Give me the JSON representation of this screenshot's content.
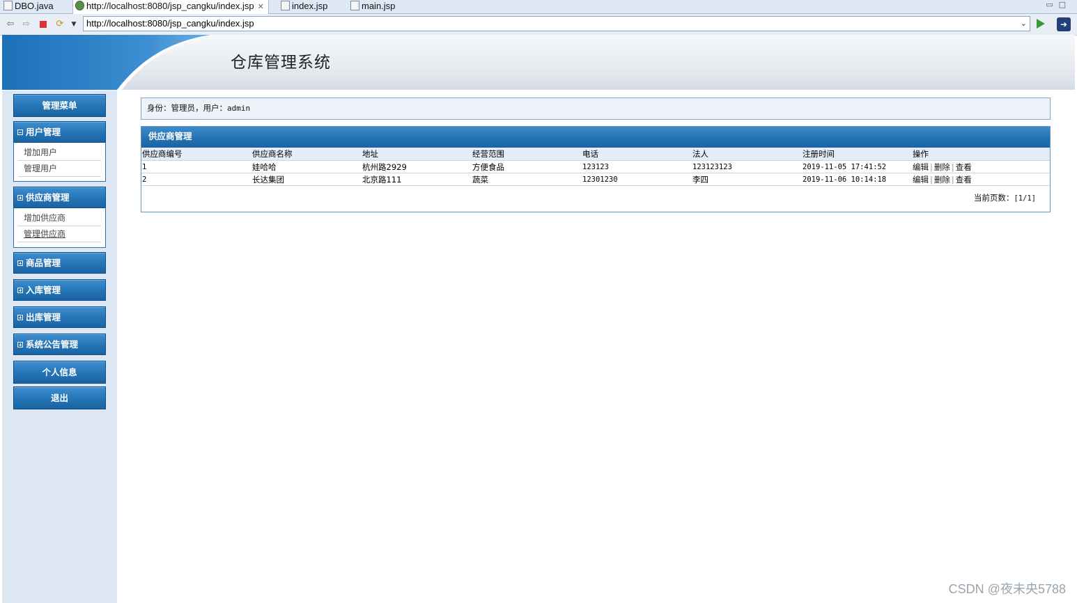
{
  "ide_tabs": [
    {
      "label": "DBO.java"
    },
    {
      "label": "http://localhost:8080/jsp_cangku/index.jsp"
    },
    {
      "label": "index.jsp"
    },
    {
      "label": "main.jsp"
    }
  ],
  "browser": {
    "url": "http://localhost:8080/jsp_cangku/index.jsp"
  },
  "header": {
    "title": "仓库管理系统"
  },
  "sidebar": {
    "menu_title": "管理菜单",
    "groups": [
      {
        "label": "用户管理",
        "expanded": true,
        "items": [
          "增加用户",
          "管理用户"
        ]
      },
      {
        "label": "供应商管理",
        "expanded": true,
        "items": [
          "增加供应商",
          "管理供应商"
        ]
      },
      {
        "label": "商品管理",
        "expanded": false
      },
      {
        "label": "入库管理",
        "expanded": false
      },
      {
        "label": "出库管理",
        "expanded": false
      },
      {
        "label": "系统公告管理",
        "expanded": false
      }
    ],
    "profile": "个人信息",
    "logout": "退出"
  },
  "identity": {
    "prefix": "身份：管理员，用户：",
    "username": "admin"
  },
  "panel": {
    "title": "供应商管理",
    "columns": [
      "供应商编号",
      "供应商名称",
      "地址",
      "经营范围",
      "电话",
      "法人",
      "注册时间",
      "操作"
    ],
    "rows": [
      {
        "id": "1",
        "name": "娃哈哈",
        "address": "杭州路2929",
        "scope": "方便食品",
        "phone": "123123",
        "legal": "123123123",
        "time": "2019-11-05 17:41:52"
      },
      {
        "id": "2",
        "name": "长达集团",
        "address": "北京路111",
        "scope": "蔬菜",
        "phone": "12301230",
        "legal": "李四",
        "time": "2019-11-06 10:14:18"
      }
    ],
    "actions": {
      "edit": "编辑",
      "delete": "删除",
      "view": "查看"
    },
    "pager_label": "当前页数：",
    "pager_value": "[1/1]"
  },
  "watermark": "CSDN @夜未央5788",
  "colors": {
    "accent_blue": "#2474b6",
    "sidebar_bg": "#dde7f3"
  }
}
